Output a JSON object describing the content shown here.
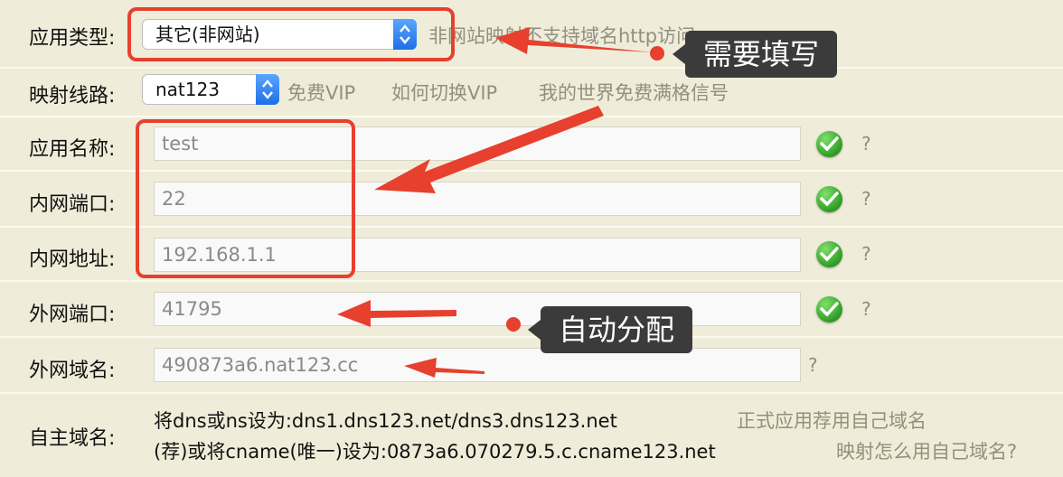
{
  "rows": {
    "app_type": {
      "label": "应用类型:",
      "select_value": "其它(非网站)",
      "note": "非网站映射不支持域名http访问"
    },
    "route": {
      "label": "映射线路:",
      "select_value": "nat123",
      "links": [
        "免费VIP",
        "如何切换VIP",
        "我的世界免费满格信号"
      ]
    },
    "app_name": {
      "label": "应用名称:",
      "value": "test",
      "help": "?"
    },
    "lan_port": {
      "label": "内网端口:",
      "value": "22",
      "help": "?"
    },
    "lan_addr": {
      "label": "内网地址:",
      "value": "192.168.1.1",
      "help": "?"
    },
    "wan_port": {
      "label": "外网端口:",
      "value": "41795",
      "help": "?"
    },
    "wan_domain": {
      "label": "外网域名:",
      "value": "490873a6.nat123.cc",
      "help": "?"
    },
    "custom_domain": {
      "label": "自主域名:",
      "line1": "将dns或ns设为:dns1.dns123.net/dns3.dns123.net",
      "line2": "(荐)或将cname(唯一)设为:0873a6.070279.5.c.cname123.net",
      "link1": "正式应用荐用自己域名",
      "link2": "映射怎么用自己域名?"
    }
  },
  "annotations": {
    "callout_fill": "需要填写",
    "callout_auto": "自动分配"
  },
  "colors": {
    "background": "#efedd9",
    "annotation_red": "#e8402e",
    "callout_bg": "#3b3b3b",
    "check_green": "#2f9c26",
    "select_blue": "#1e6fe8"
  }
}
